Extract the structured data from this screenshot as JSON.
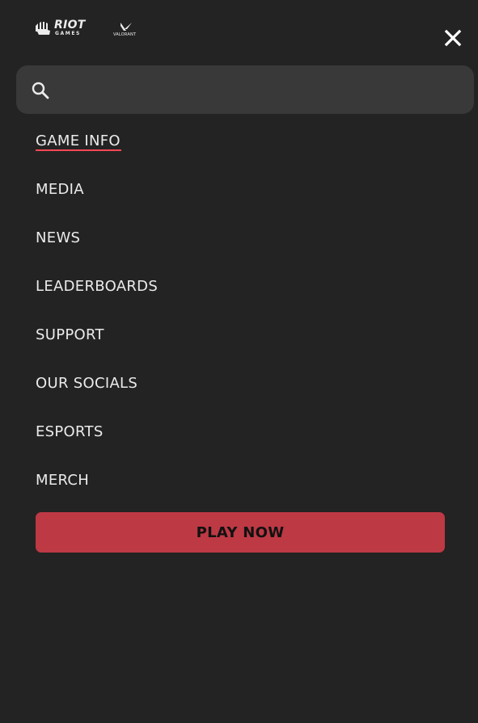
{
  "header": {
    "riot_logo": {
      "title": "RIOT",
      "subtitle": "GAMES"
    },
    "valorant_logo": {
      "wordmark": "VALORANT"
    },
    "close_icon": "close-icon"
  },
  "search": {
    "placeholder": "",
    "value": "",
    "icon": "search-icon"
  },
  "nav": {
    "items": [
      {
        "label": "GAME INFO",
        "active": true
      },
      {
        "label": "MEDIA",
        "active": false
      },
      {
        "label": "NEWS",
        "active": false
      },
      {
        "label": "LEADERBOARDS",
        "active": false
      },
      {
        "label": "SUPPORT",
        "active": false
      },
      {
        "label": "OUR SOCIALS",
        "active": false
      },
      {
        "label": "ESPORTS",
        "active": false
      },
      {
        "label": "MERCH",
        "active": false
      }
    ]
  },
  "cta": {
    "play_label": "PLAY NOW"
  },
  "colors": {
    "background": "#232323",
    "search_background": "#393939",
    "text": "#ebebeb",
    "active_underline": "#ff4655",
    "cta_background": "#bd3944"
  }
}
